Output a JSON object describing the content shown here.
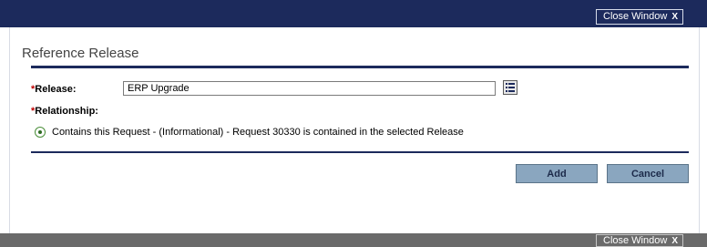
{
  "header": {
    "close_label": "Close Window",
    "close_x": "X"
  },
  "dialog": {
    "title": "Reference Release",
    "release": {
      "required_mark": "*",
      "label": "Release:",
      "value": "ERP Upgrade"
    },
    "relationship": {
      "required_mark": "*",
      "label": "Relationship:",
      "option_text": "Contains this Request - (Informational) - Request 30330 is contained in the selected Release",
      "selected": true
    },
    "buttons": {
      "add": "Add",
      "cancel": "Cancel"
    }
  },
  "footer": {
    "close_label": "Close Window",
    "close_x": "X"
  },
  "colors": {
    "bar": "#1c2a5c",
    "button": "#8aa6bf",
    "footer": "#6a6a6a"
  }
}
